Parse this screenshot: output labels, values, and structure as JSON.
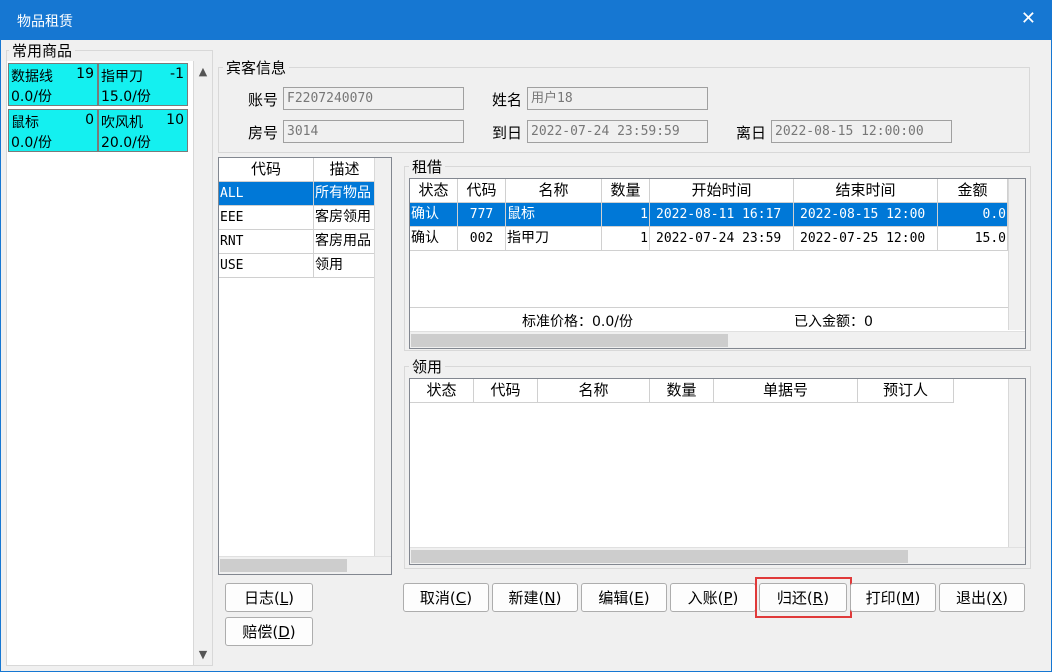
{
  "window": {
    "title": "物品租赁",
    "close_glyph": "✕"
  },
  "favorites": {
    "legend": "常用商品",
    "items": [
      {
        "name": "数据线",
        "count": "19",
        "price": "0.0/份"
      },
      {
        "name": "指甲刀",
        "count": "-1",
        "price": "15.0/份"
      },
      {
        "name": "鼠标",
        "count": "0",
        "price": "0.0/份"
      },
      {
        "name": "吹风机",
        "count": "10",
        "price": "20.0/份"
      }
    ],
    "scroll_up": "▲",
    "scroll_down": "▼"
  },
  "guest": {
    "legend": "宾客信息",
    "account_label": "账号",
    "account_value": "F2207240070",
    "name_label": "姓名",
    "name_value": "用户18",
    "room_label": "房号",
    "room_value": "3014",
    "arrive_label": "到日",
    "arrive_value": "2022-07-24 23:59:59",
    "depart_label": "离日",
    "depart_value": "2022-08-15 12:00:00"
  },
  "category_grid": {
    "headers": [
      "代码",
      "描述"
    ],
    "rows": [
      {
        "code": "ALL",
        "desc": "所有物品"
      },
      {
        "code": "EEE",
        "desc": "客房领用"
      },
      {
        "code": "RNT",
        "desc": "客房用品"
      },
      {
        "code": "USE",
        "desc": "领用"
      }
    ]
  },
  "rental": {
    "legend": "租借",
    "headers": [
      "状态",
      "代码",
      "名称",
      "数量",
      "开始时间",
      "结束时间",
      "金额"
    ],
    "rows": [
      {
        "status": "确认",
        "code": "777",
        "name": "鼠标",
        "qty": "1",
        "start": "2022-08-11 16:17",
        "end": "2022-08-15 12:00",
        "amount": "0.0"
      },
      {
        "status": "确认",
        "code": "002",
        "name": "指甲刀",
        "qty": "1",
        "start": "2022-07-24 23:59",
        "end": "2022-07-25 12:00",
        "amount": "15.0"
      }
    ],
    "std_price": "标准价格：0.0/份",
    "posted_amount": "已入金额：0"
  },
  "usage": {
    "legend": "领用",
    "headers": [
      "状态",
      "代码",
      "名称",
      "数量",
      "单据号",
      "预订人"
    ]
  },
  "buttons": {
    "log": {
      "text": "日志(",
      "key": "L",
      "end": ")"
    },
    "compensate": {
      "text": "赔偿(",
      "key": "D",
      "end": ")"
    },
    "cancel": {
      "text": "取消(",
      "key": "C",
      "end": ")"
    },
    "new": {
      "text": "新建(",
      "key": "N",
      "end": ")"
    },
    "edit": {
      "text": "编辑(",
      "key": "E",
      "end": ")"
    },
    "post": {
      "text": "入账(",
      "key": "P",
      "end": ")"
    },
    "return": {
      "text": "归还(",
      "key": "R",
      "end": ")"
    },
    "print": {
      "text": "打印(",
      "key": "M",
      "end": ")"
    },
    "exit": {
      "text": "退出(",
      "key": "X",
      "end": ")"
    }
  },
  "colors": {
    "titlebar": "#1677d2",
    "item_bg": "#14f0f0",
    "selection": "#0078d7",
    "highlight": "#e03a3a"
  }
}
